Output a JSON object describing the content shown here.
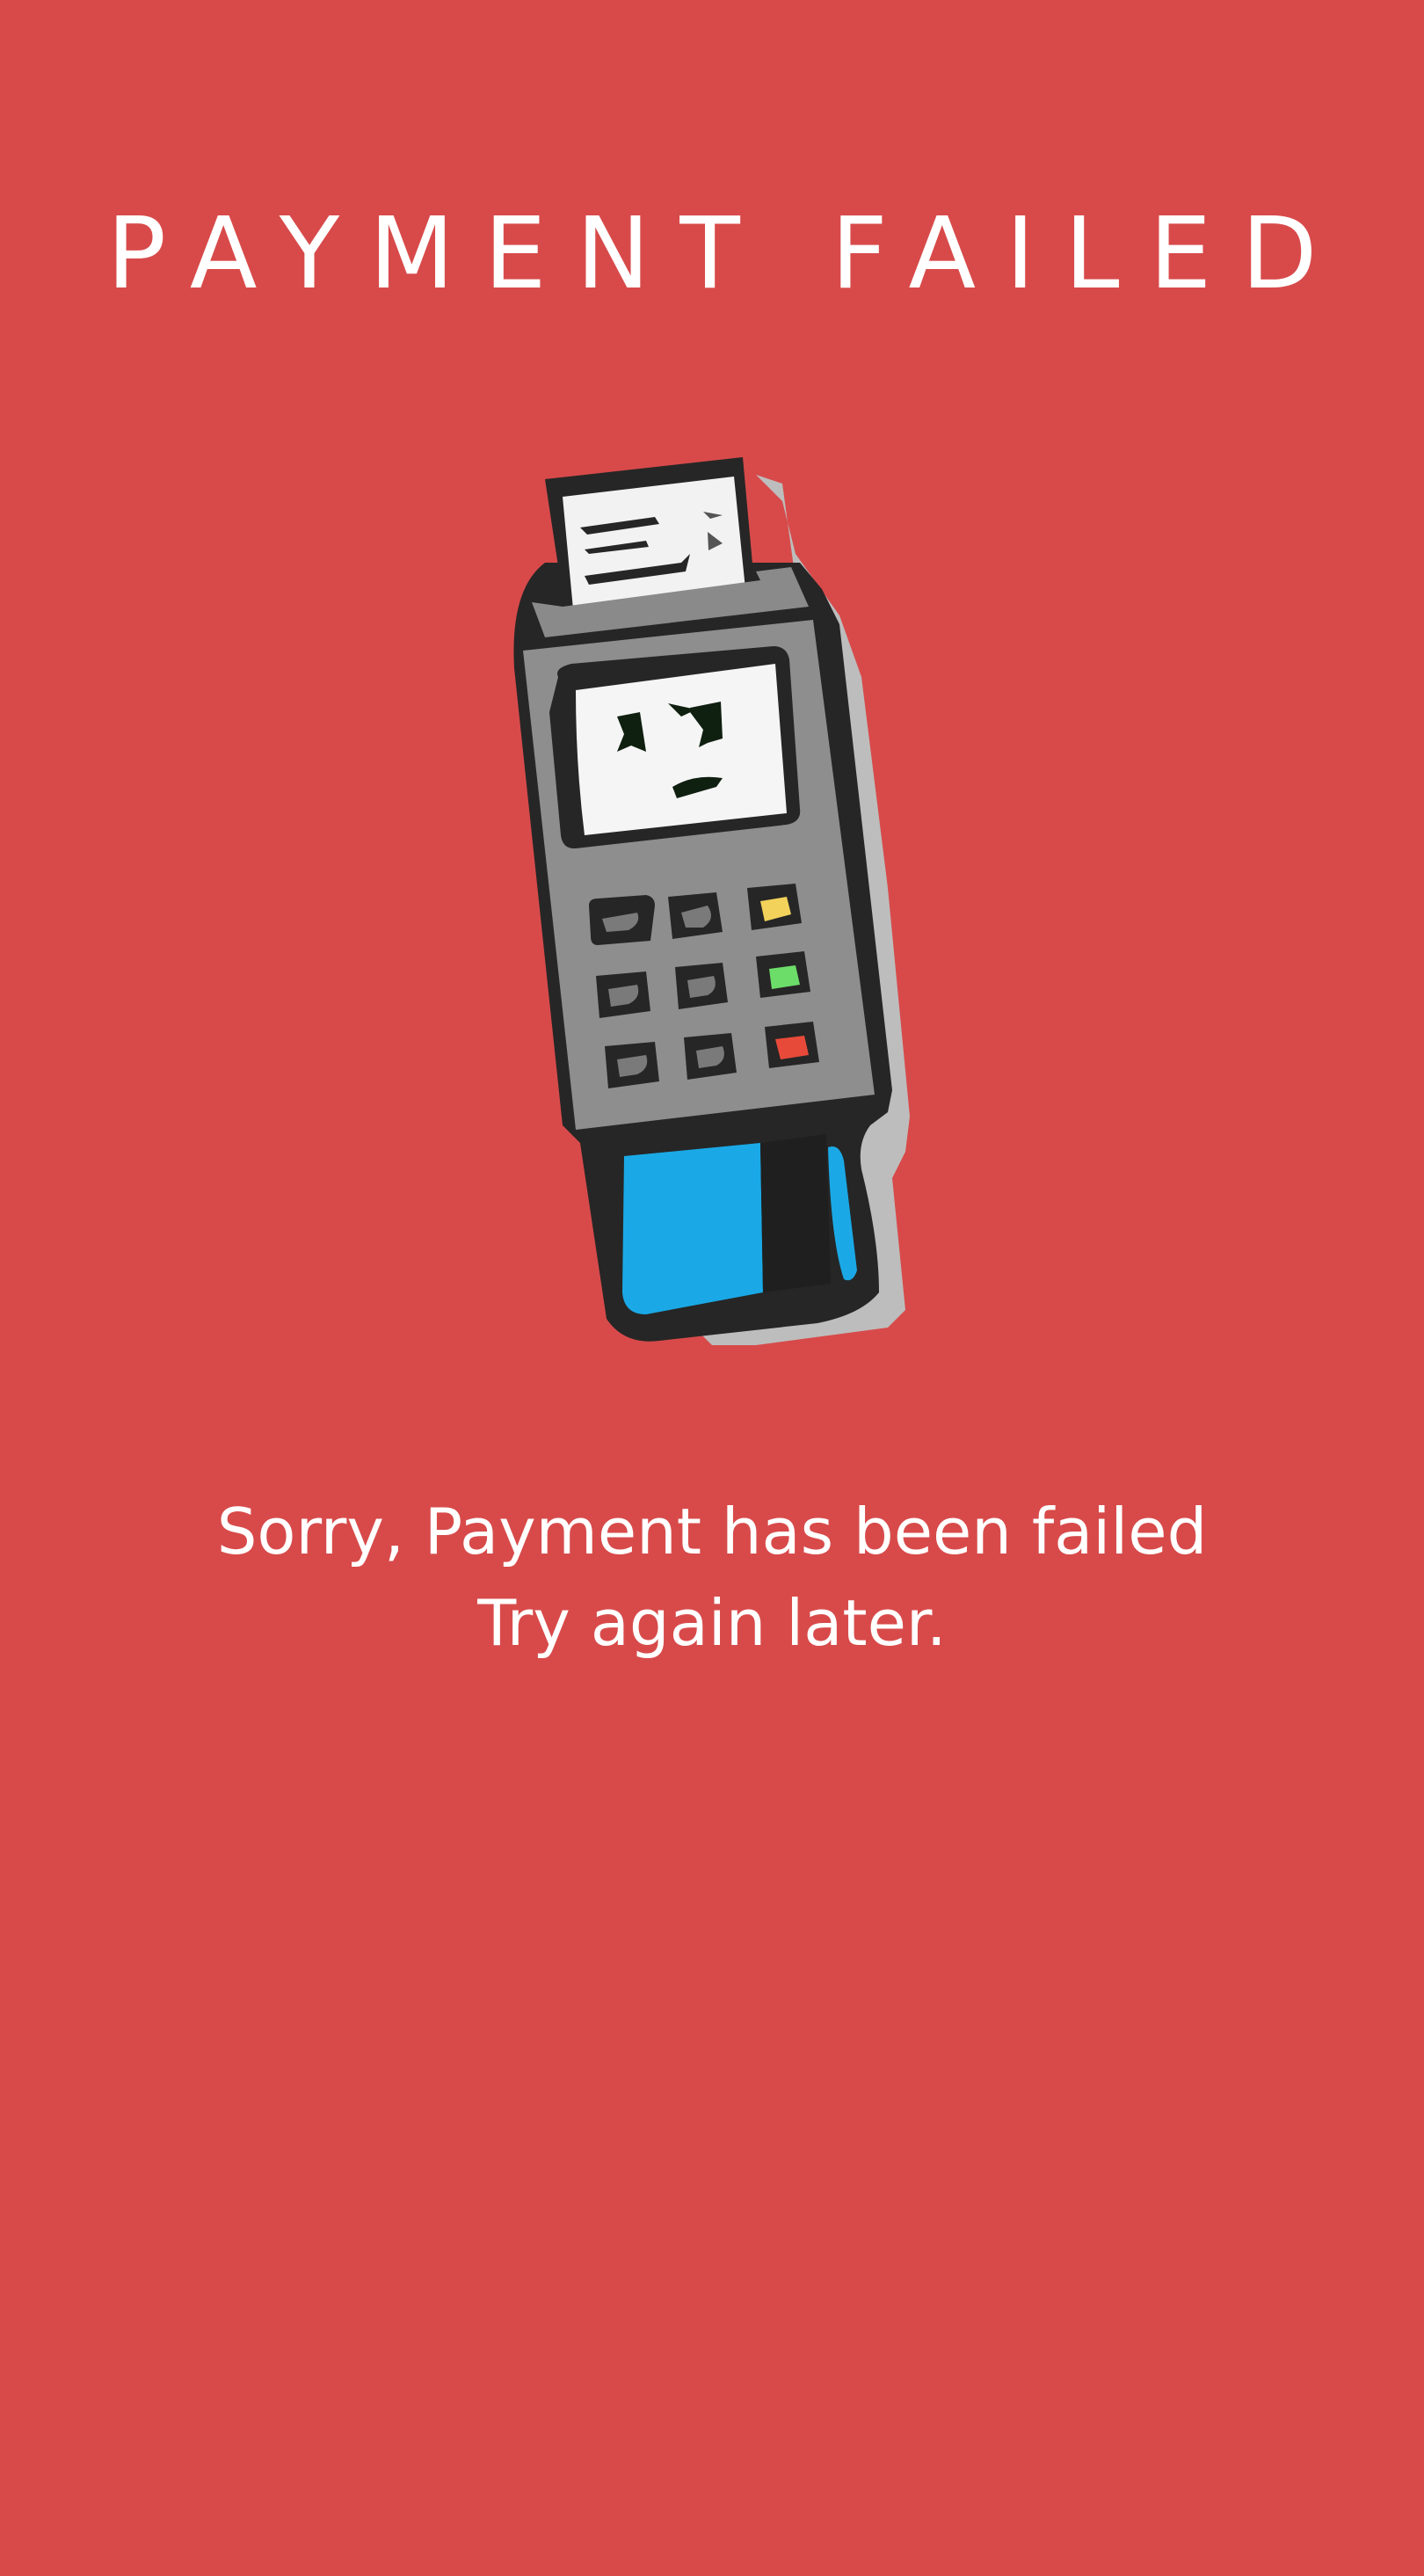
{
  "screen": {
    "background_color": "#d84a4a",
    "title": "PAYMENT FAILED",
    "illustration_icon": "sad-card-terminal-icon",
    "message": {
      "line1": "Sorry, Payment has been failed",
      "line2": "Try again later."
    }
  }
}
